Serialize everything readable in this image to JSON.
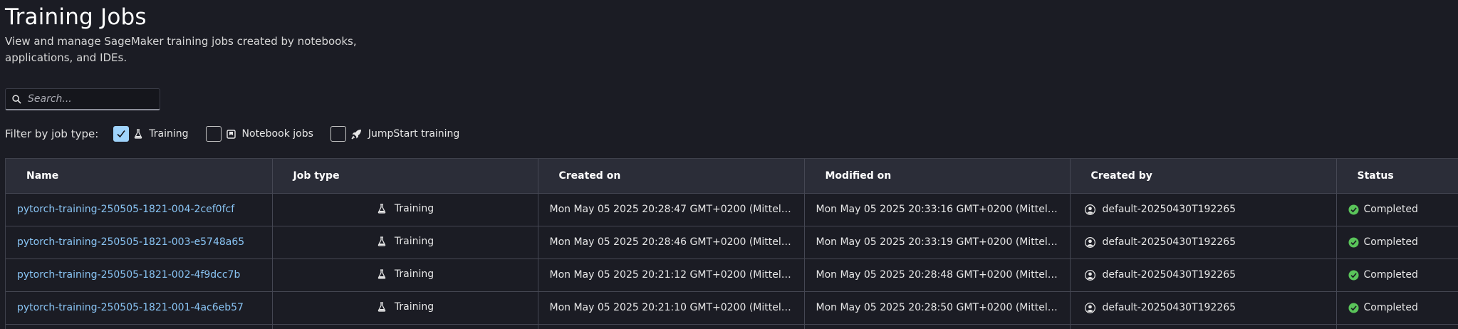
{
  "header": {
    "title": "Training Jobs",
    "subtitle_line1": "View and manage SageMaker training jobs created by notebooks,",
    "subtitle_line2": "applications, and IDEs."
  },
  "search": {
    "placeholder": "Search...",
    "value": ""
  },
  "filter": {
    "label": "Filter by job type:",
    "options": [
      {
        "label": "Training",
        "checked": true,
        "icon": "flask-icon"
      },
      {
        "label": "Notebook jobs",
        "checked": false,
        "icon": "notebook-icon"
      },
      {
        "label": "JumpStart training",
        "checked": false,
        "icon": "rocket-icon"
      }
    ]
  },
  "table": {
    "columns": [
      "Name",
      "Job type",
      "Created on",
      "Modified on",
      "Created by",
      "Status"
    ],
    "rows": [
      {
        "name": "pytorch-training-250505-1821-004-2cef0fcf",
        "job_type": "Training",
        "created_on": "Mon May 05 2025 20:28:47 GMT+0200 (Mitteleuro...",
        "modified_on": "Mon May 05 2025 20:33:16 GMT+0200 (Mitteleuro...",
        "created_by": "default-20250430T192265",
        "status": "Completed"
      },
      {
        "name": "pytorch-training-250505-1821-003-e5748a65",
        "job_type": "Training",
        "created_on": "Mon May 05 2025 20:28:46 GMT+0200 (Mitteleuro...",
        "modified_on": "Mon May 05 2025 20:33:19 GMT+0200 (Mitteleuro...",
        "created_by": "default-20250430T192265",
        "status": "Completed"
      },
      {
        "name": "pytorch-training-250505-1821-002-4f9dcc7b",
        "job_type": "Training",
        "created_on": "Mon May 05 2025 20:21:12 GMT+0200 (Mitteleuro...",
        "modified_on": "Mon May 05 2025 20:28:48 GMT+0200 (Mitteleuro...",
        "created_by": "default-20250430T192265",
        "status": "Completed"
      },
      {
        "name": "pytorch-training-250505-1821-001-4ac6eb57",
        "job_type": "Training",
        "created_on": "Mon May 05 2025 20:21:10 GMT+0200 (Mitteleuro...",
        "modified_on": "Mon May 05 2025 20:28:50 GMT+0200 (Mitteleuro...",
        "created_by": "default-20250430T192265",
        "status": "Completed"
      }
    ]
  },
  "colors": {
    "background": "#1b1c24",
    "header_bg": "#2b2d38",
    "link": "#89c4f4",
    "checkbox_checked": "#9fd3fb",
    "status_success": "#5ac45a"
  }
}
